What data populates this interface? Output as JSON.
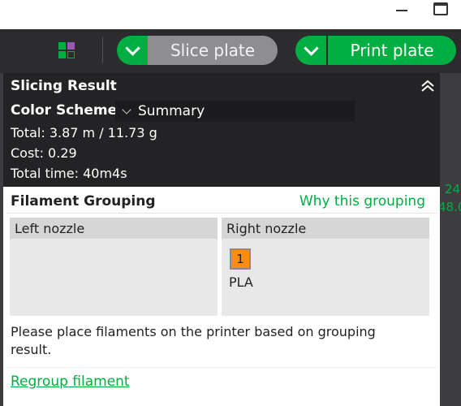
{
  "toolbar": {
    "slice_label": "Slice plate",
    "print_label": "Print plate"
  },
  "canvas": {
    "overlay_line1": "24",
    "overlay_line2": "48.0"
  },
  "slicing_result": {
    "title": "Slicing Result",
    "color_scheme_label": "Color Scheme",
    "color_scheme_value": "Summary",
    "total": "Total: 3.87 m / 11.73 g",
    "cost": "Cost: 0.29",
    "total_time": "Total time: 40m4s"
  },
  "filament_grouping": {
    "title": "Filament Grouping",
    "why_link": "Why this grouping",
    "left_nozzle": "Left nozzle",
    "right_nozzle": "Right nozzle",
    "right_filaments": [
      {
        "index": "1",
        "type": "PLA",
        "color": "#ff8c12"
      }
    ],
    "note": "Please place filaments on the printer based on grouping result.",
    "regroup_link": "Regroup filament"
  },
  "colors": {
    "accent_green": "#00ae42",
    "panel_dark": "#232325",
    "slice_button_gray": "#8e8e92"
  }
}
